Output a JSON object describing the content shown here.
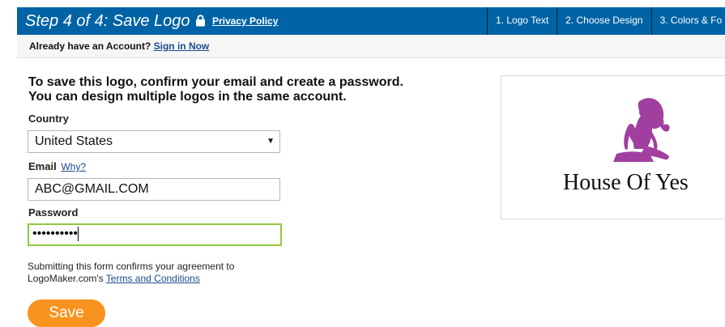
{
  "header": {
    "step_title": "Step 4 of 4: Save Logo",
    "privacy_link": "Privacy Policy",
    "steps": [
      "1. Logo Text",
      "2. Choose Design",
      "3. Colors & Fo"
    ]
  },
  "account_bar": {
    "text": "Already have an Account?",
    "link": "Sign in Now"
  },
  "form": {
    "intro_line1": "To save this logo, confirm your email and create a password.",
    "intro_line2": "You can design multiple logos in the same account.",
    "country_label": "Country",
    "country_value": "United States",
    "email_label": "Email",
    "email_why": "Why?",
    "email_value": "ABC@GMAIL.COM",
    "password_label": "Password",
    "password_value": "••••••••••",
    "agree_line1": "Submitting this form confirms your agreement to",
    "agree_line2_prefix": "LogoMaker.com's",
    "agree_link": "Terms and Conditions",
    "save_label": "Save"
  },
  "preview": {
    "brand_text": "House Of Yes",
    "brand_color": "#a03fa0"
  },
  "colors": {
    "header_blue": "#0063a5",
    "save_orange": "#f7931e",
    "focus_green": "#92c83e"
  }
}
